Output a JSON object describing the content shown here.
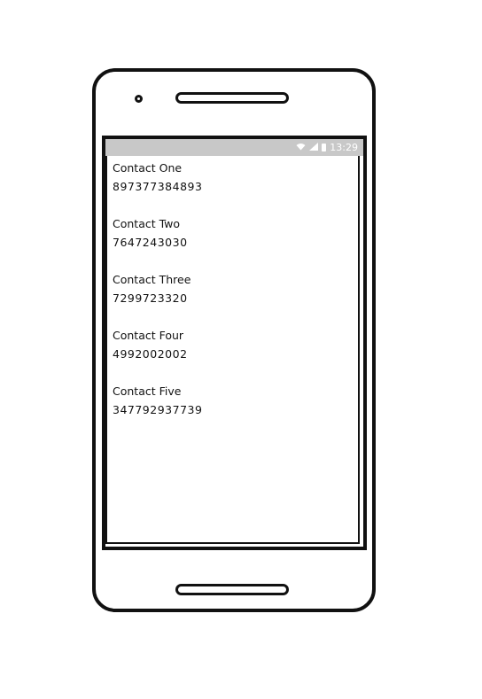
{
  "status_bar": {
    "wifi_icon": "wifi-icon",
    "signal_icon": "signal-icon",
    "battery_icon": "battery-icon",
    "time": "13:29"
  },
  "contacts": [
    {
      "name": "Contact One",
      "phone": "897377384893"
    },
    {
      "name": "Contact Two",
      "phone": "7647243030"
    },
    {
      "name": "Contact Three",
      "phone": "7299723320"
    },
    {
      "name": "Contact Four",
      "phone": "4992002002"
    },
    {
      "name": "Contact Five",
      "phone": "347792937739"
    }
  ]
}
